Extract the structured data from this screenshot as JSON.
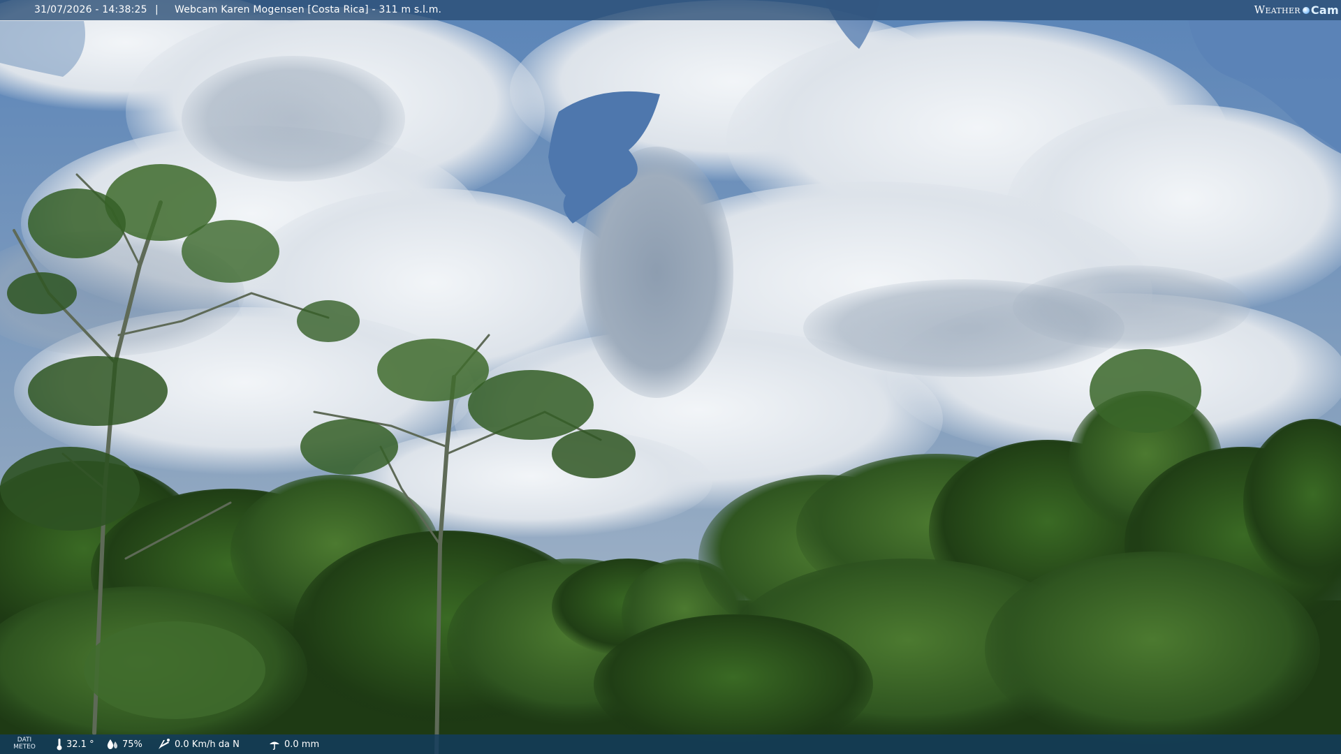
{
  "overlay": {
    "timestamp": "31/07/2026 - 14:38:25",
    "separator": "|",
    "title": "Webcam Karen Mogensen [Costa Rica] - 311 m s.l.m.",
    "logo": {
      "part1": "Weather",
      "part2": "Cam"
    }
  },
  "weather": {
    "label_line1": "DATI",
    "label_line2": "METEO",
    "temperature": "32.1 °",
    "humidity": "75%",
    "wind": "0.0 Km/h da N",
    "rain": "0.0 mm"
  },
  "icons": {
    "temperature": "thermometer-icon",
    "humidity": "humidity-drop-icon",
    "wind": "wind-icon",
    "rain": "rain-icon",
    "logo": "weathercam-globe-icon"
  },
  "colors": {
    "sky_blue": "#5a87be",
    "cloud": "#e6ebf1",
    "foliage_dark": "#1f3e14",
    "foliage_mid": "#3f6b28",
    "overlay_bar": "#284b73",
    "bottom_bar": "#123c5f"
  }
}
